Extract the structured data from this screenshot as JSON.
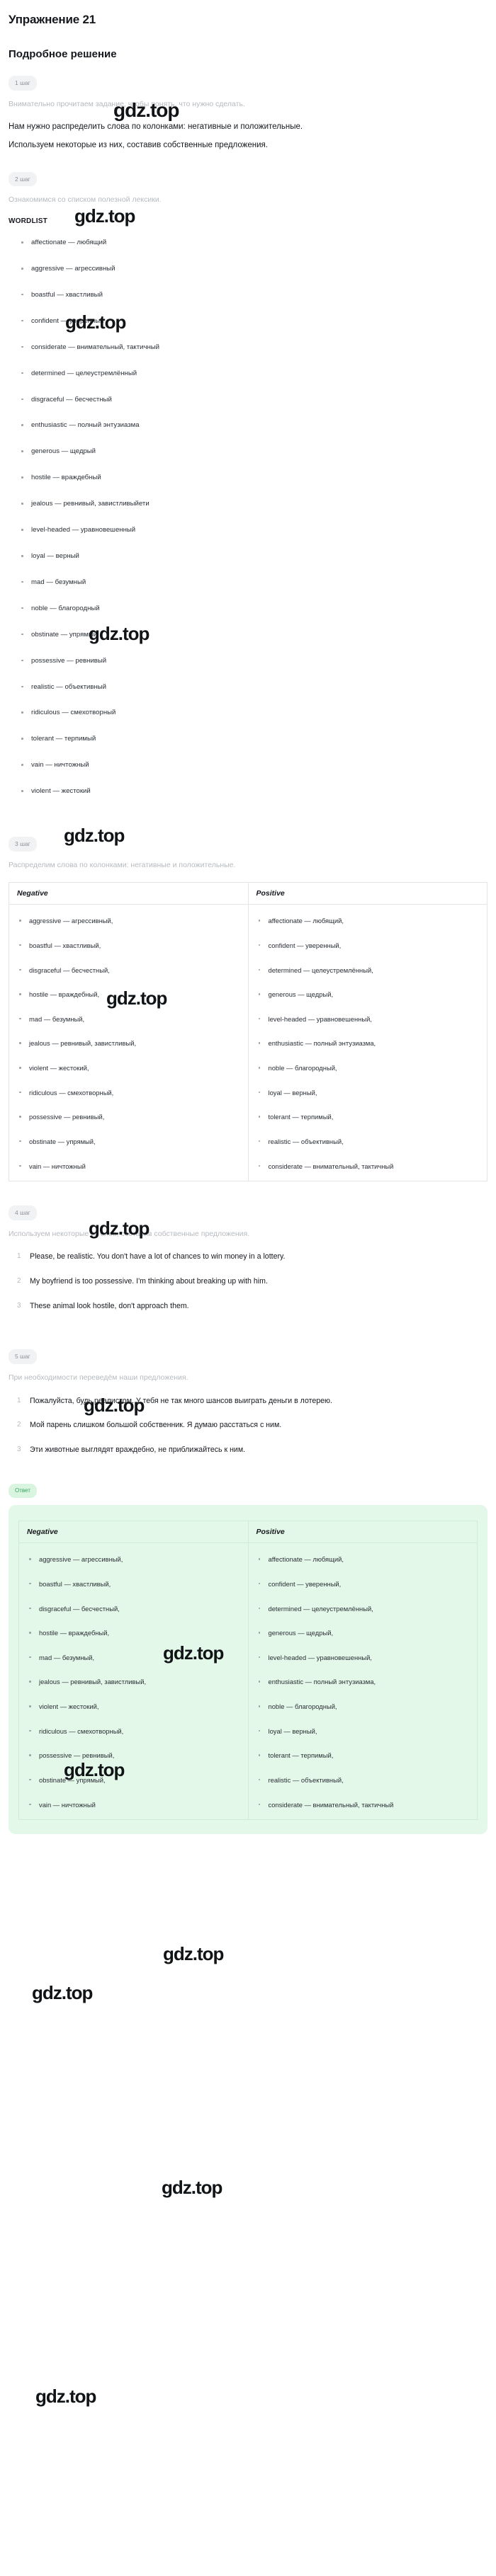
{
  "exercise": {
    "title": "Упражнение 21",
    "solution_heading": "Подробное решение"
  },
  "steps": {
    "s1": {
      "badge": "1 шаг",
      "note": "Внимательно прочитаем задание, чтобы понять, что нужно сделать.",
      "line1": "Нам нужно распределить слова по колонками: негативные и положительные.",
      "line2": "Используем некоторые из них, составив собственные предложения."
    },
    "s2": {
      "badge": "2 шаг",
      "note": "Ознакомимся со списком полезной лексики.",
      "wordlist_heading": "WORDLIST"
    },
    "s3": {
      "badge": "3 шаг",
      "note": "Распределим слова по колонками: негативные и положительные."
    },
    "s4": {
      "badge": "4 шаг",
      "note": "Используем некоторые из слов, составив собственные предложения."
    },
    "s5": {
      "badge": "5 шаг",
      "note": "При необходимости переведём наши предложения."
    }
  },
  "wordlist": [
    "affectionate — любящий",
    "aggressive — агрессивный",
    "boastful — хвастливый",
    "confident — уверенный",
    "considerate — внимательный, тактичный",
    "determined — целеустремлённый",
    "disgraceful — бесчестный",
    "enthusiastic — полный энтузиазма",
    "generous — щедрый",
    "hostile — враждебный",
    "jealous — ревнивый, завистливыйети",
    "level-headed — уравновешенный",
    "loyal — верный",
    "mad — безумный",
    "noble — благородный",
    "obstinate — упрямый",
    "possessive — ревнивый",
    "realistic — объективный",
    "ridiculous — смехотворный",
    "tolerant — терпимый",
    "vain — ничтожный",
    "violent — жестокий"
  ],
  "table": {
    "headers": {
      "negative": "Negative",
      "positive": "Positive"
    },
    "negative": [
      "aggressive — агрессивный,",
      "boastful — хвастливый,",
      "disgraceful — бесчестный,",
      "hostile — враждебный,",
      "mad — безумный,",
      "jealous — ревнивый, завистливый,",
      "violent — жестокий,",
      "ridiculous — смехотворный,",
      "possessive — ревнивый,",
      "obstinate — упрямый,",
      "vain — ничтожный"
    ],
    "positive": [
      "affectionate — любящий,",
      "confident — уверенный,",
      "determined — целеустремлённый,",
      "generous — щедрый,",
      "level-headed — уравновешенный,",
      "enthusiastic — полный энтузиазма,",
      "noble — благородный,",
      "loyal — верный,",
      "tolerant — терпимый,",
      "realistic — объективный,",
      "considerate — внимательный, тактичный"
    ]
  },
  "sentences_en": [
    "Please, be realistic. You don't have a lot of chances to win money in a lottery.",
    "My boyfriend is too possessive. I'm thinking about breaking up with him.",
    "These animal look hostile, don't approach them."
  ],
  "sentences_ru": [
    "Пожалуйста, будь реалистом. У тебя не так много шансов выиграть деньги в лотерею.",
    "Мой парень слишком большой собственник. Я думаю расстаться с ним.",
    "Эти животные выглядят враждебно, не приближайтесь к ним."
  ],
  "answer": {
    "badge": "Ответ"
  },
  "watermark": {
    "text": "gdz.top"
  },
  "colors": {
    "answer_bg": "#e4f8e9",
    "answer_badge_bg": "#d9f5e0",
    "answer_badge_fg": "#3aa35c",
    "step_badge_bg": "#f1f2f4"
  }
}
